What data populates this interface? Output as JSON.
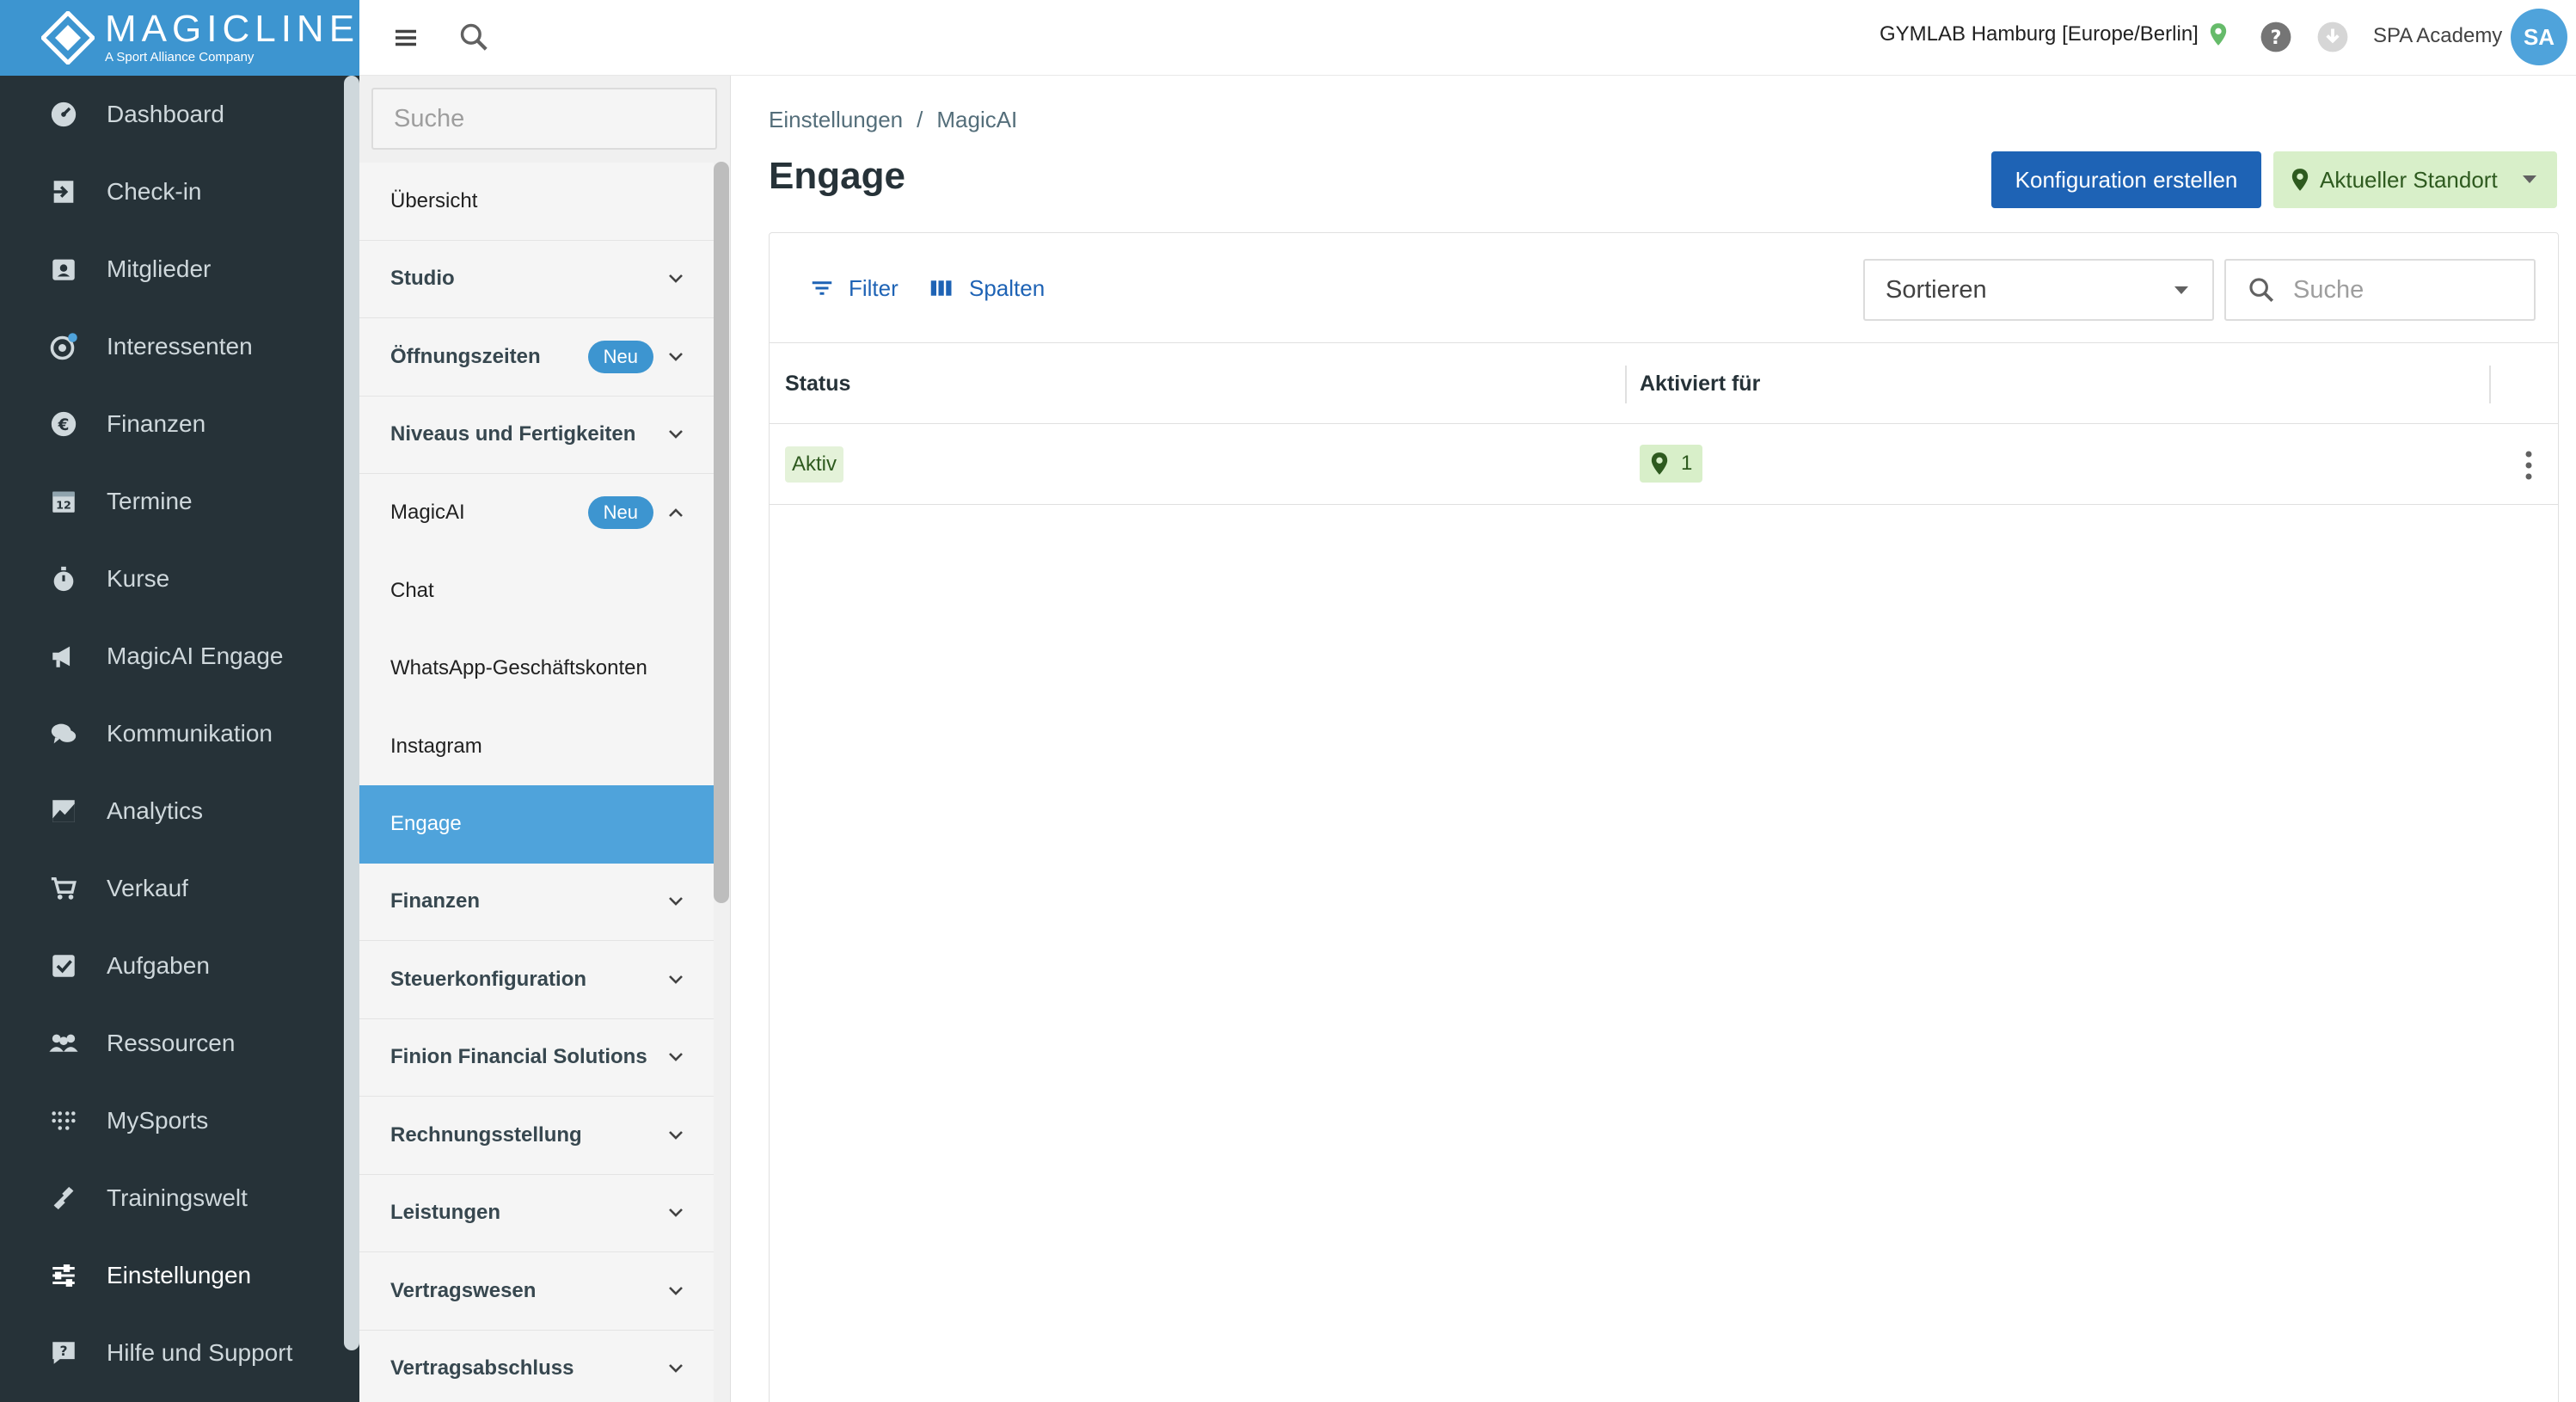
{
  "brand": {
    "name": "MAGICLINE",
    "tagline": "A Sport Alliance Company"
  },
  "nav": {
    "items": [
      {
        "label": "Dashboard",
        "icon": "dashboard-icon"
      },
      {
        "label": "Check-in",
        "icon": "check-in-icon"
      },
      {
        "label": "Mitglieder",
        "icon": "members-icon"
      },
      {
        "label": "Interessenten",
        "icon": "leads-icon"
      },
      {
        "label": "Finanzen",
        "icon": "euro-icon"
      },
      {
        "label": "Termine",
        "icon": "calendar-icon"
      },
      {
        "label": "Kurse",
        "icon": "stopwatch-icon"
      },
      {
        "label": "MagicAI Engage",
        "icon": "megaphone-icon"
      },
      {
        "label": "Kommunikation",
        "icon": "chat-icon"
      },
      {
        "label": "Analytics",
        "icon": "chart-icon"
      },
      {
        "label": "Verkauf",
        "icon": "cart-icon"
      },
      {
        "label": "Aufgaben",
        "icon": "checkbox-icon"
      },
      {
        "label": "Ressourcen",
        "icon": "people-icon"
      },
      {
        "label": "MySports",
        "icon": "dots-grid-icon"
      },
      {
        "label": "Trainingswelt",
        "icon": "dumbbell-icon"
      },
      {
        "label": "Einstellungen",
        "icon": "sliders-icon"
      },
      {
        "label": "Hilfe und Support",
        "icon": "help-chat-icon"
      }
    ]
  },
  "subnav": {
    "search_placeholder": "Suche",
    "items": [
      {
        "label": "Übersicht"
      },
      {
        "label": "Studio"
      },
      {
        "label": "Öffnungszeiten",
        "badge": "Neu"
      },
      {
        "label": "Niveaus und Fertigkeiten"
      },
      {
        "label": "MagicAI",
        "badge": "Neu"
      },
      {
        "label": "Chat"
      },
      {
        "label": "WhatsApp-Geschäftskonten"
      },
      {
        "label": "Instagram"
      },
      {
        "label": "Engage"
      },
      {
        "label": "Finanzen"
      },
      {
        "label": "Steuerkonfiguration"
      },
      {
        "label": "Finion Financial Solutions"
      },
      {
        "label": "Rechnungsstellung"
      },
      {
        "label": "Leistungen"
      },
      {
        "label": "Vertragswesen"
      },
      {
        "label": "Vertragsabschluss"
      }
    ]
  },
  "topbar": {
    "location": "GYMLAB Hamburg [Europe/Berlin]",
    "user": "SPA Academy",
    "avatar": "SA"
  },
  "main": {
    "breadcrumb": [
      "Einstellungen",
      "/",
      "MagicAI"
    ],
    "title": "Engage",
    "create_button": "Konfiguration erstellen",
    "location_button": "Aktueller Standort",
    "filter_label": "Filter",
    "columns_label": "Spalten",
    "sort_label": "Sortieren",
    "search_placeholder": "Suche",
    "table": {
      "headers": [
        "Status",
        "Aktiviert für"
      ],
      "rows": [
        {
          "status": "Aktiv",
          "activated_for": "1"
        }
      ]
    }
  },
  "colors": {
    "brand": "#3d95d0",
    "nav_bg": "#263238",
    "primary": "#1e63b5",
    "success_bg": "#d8efc9"
  }
}
